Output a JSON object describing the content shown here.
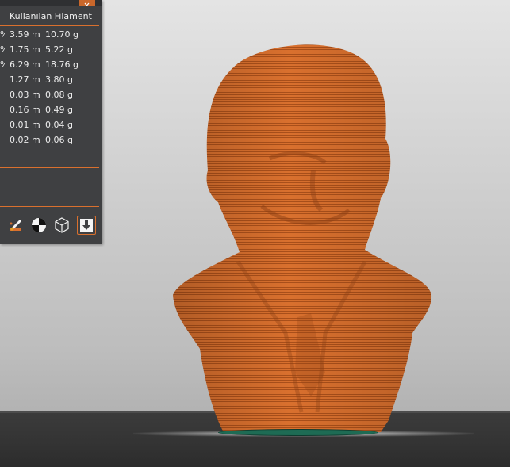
{
  "panel": {
    "header": "Kullanılan Filament",
    "rows": [
      {
        "pct": "%",
        "length": "3.59 m",
        "weight": "10.70 g"
      },
      {
        "pct": "%",
        "length": "1.75 m",
        "weight": "5.22 g"
      },
      {
        "pct": "%",
        "length": "6.29 m",
        "weight": "18.76 g"
      },
      {
        "pct": "",
        "length": "1.27 m",
        "weight": "3.80 g"
      },
      {
        "pct": "",
        "length": "0.03 m",
        "weight": "0.08 g"
      },
      {
        "pct": "",
        "length": "0.16 m",
        "weight": "0.49 g"
      },
      {
        "pct": "",
        "length": "0.01 m",
        "weight": "0.04 g"
      },
      {
        "pct": "",
        "length": "0.02 m",
        "weight": "0.06 g"
      }
    ],
    "toolbar": [
      {
        "icon": "paint-brush-icon"
      },
      {
        "icon": "half-circle-icon"
      },
      {
        "icon": "wireframe-cube-icon"
      },
      {
        "icon": "download-arrow-icon",
        "active": true
      }
    ]
  },
  "colors": {
    "accent": "#d9702e",
    "model": "#d9702e",
    "panel_bg": "#3f4042",
    "brim": "#1e6b54"
  }
}
